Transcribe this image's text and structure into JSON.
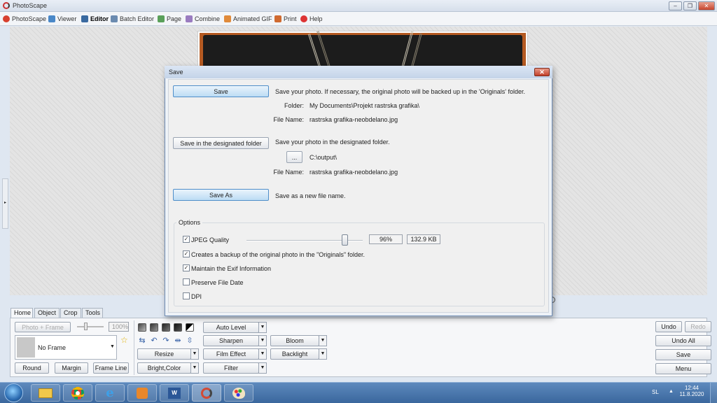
{
  "app": {
    "title": "PhotoScape"
  },
  "menu": [
    {
      "label": "PhotoScape",
      "icon": "photoscape-icon"
    },
    {
      "label": "Viewer",
      "icon": "viewer-icon"
    },
    {
      "label": "Editor",
      "icon": "editor-icon",
      "active": true
    },
    {
      "label": "Batch Editor",
      "icon": "batch-editor-icon"
    },
    {
      "label": "Page",
      "icon": "page-icon"
    },
    {
      "label": "Combine",
      "icon": "combine-icon"
    },
    {
      "label": "Animated GIF",
      "icon": "animated-gif-icon"
    },
    {
      "label": "Print",
      "icon": "print-icon"
    },
    {
      "label": "Help",
      "icon": "help-icon"
    }
  ],
  "tabs": [
    "Home",
    "Object",
    "Crop",
    "Tools"
  ],
  "home": {
    "photo_frame_btn": "Photo + Frame",
    "zoom": "100%",
    "frame_select": "No Frame",
    "round_btn": "Round",
    "margin_btn": "Margin",
    "frame_line_btn": "Frame Line"
  },
  "tools": {
    "auto_level": "Auto Level",
    "sharpen": "Sharpen",
    "bloom": "Bloom",
    "resize": "Resize",
    "film_effect": "Film Effect",
    "backlight": "Backlight",
    "bright_color": "Bright,Color",
    "filter": "Filter"
  },
  "right_actions": {
    "undo": "Undo",
    "redo": "Redo",
    "undo_all": "Undo All",
    "save": "Save",
    "menu": "Menu"
  },
  "dialog": {
    "title": "Save",
    "save_btn": "Save",
    "save_desc": "Save your photo. If necessary, the original photo will be backed up in the 'Originals' folder.",
    "folder_label": "Folder:",
    "folder_value": "My Documents\\Projekt rastrska grafika\\",
    "file_name_label": "File Name:",
    "file_name_value": "rastrska grafika-neobdelano.jpg",
    "designated_btn": "Save in the designated folder",
    "designated_desc": "Save your photo in the designated folder.",
    "browse_btn": "...",
    "output_path": "C:\\output\\",
    "file_name_label2": "File Name:",
    "file_name_value2": "rastrska grafika-neobdelano.jpg",
    "save_as_btn": "Save As",
    "save_as_desc": "Save as a new file name.",
    "options_label": "Options",
    "jpeg_quality_label": "JPEG Quality",
    "jpeg_quality_percent": "96%",
    "jpeg_quality_value": 0.96,
    "file_size": "132.9 KB",
    "options": [
      {
        "label": "JPEG Quality",
        "checked": true
      },
      {
        "label": "Creates a backup of the original photo in the \"Originals\" folder.",
        "checked": true
      },
      {
        "label": "Maintain the Exif Information",
        "checked": true
      },
      {
        "label": "Preserve File Date",
        "checked": false
      },
      {
        "label": "DPI",
        "checked": false
      }
    ]
  },
  "taskbar": {
    "items": [
      "start-orb-icon",
      "file-explorer-icon",
      "chrome-icon",
      "internet-explorer-icon",
      "media-player-icon",
      "word-icon",
      "photoscape-icon",
      "paint-icon"
    ],
    "language": "SL",
    "time": "12:44",
    "date": "11.8.2020"
  },
  "colors": {
    "accent_blue": "#4f8ec9",
    "taskbar": "#3a679d",
    "close_red": "#c6432b"
  }
}
